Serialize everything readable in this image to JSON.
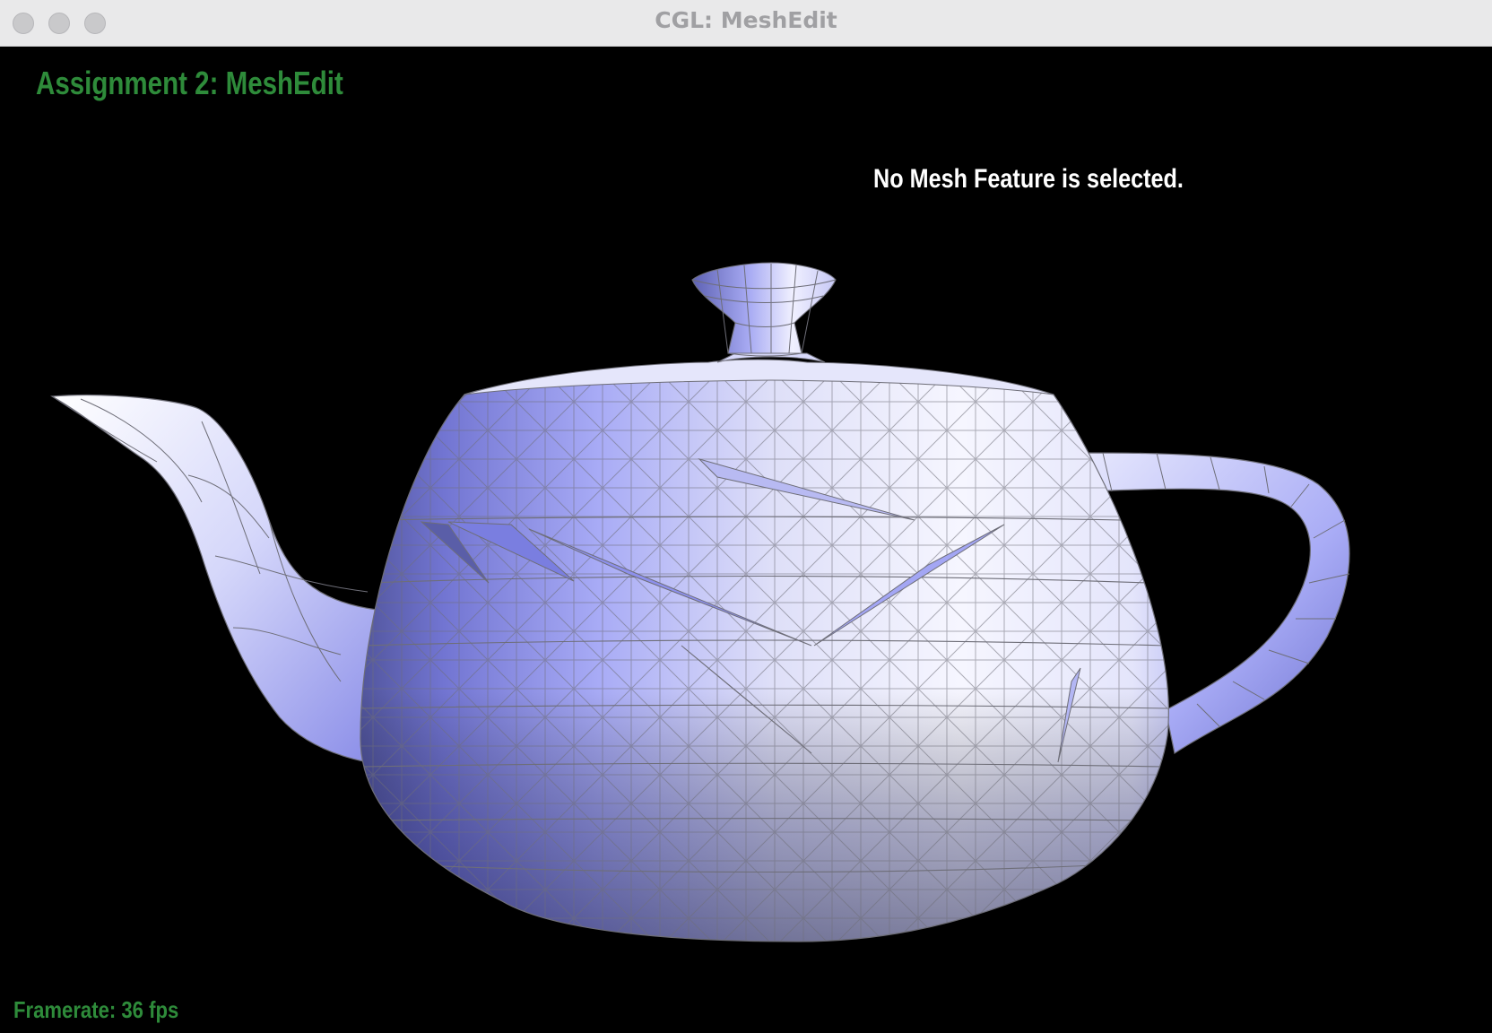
{
  "window": {
    "title": "CGL: MeshEdit",
    "controls": [
      "close",
      "minimize",
      "zoom"
    ]
  },
  "viewer": {
    "heading": "Assignment 2: MeshEdit",
    "status": "No Mesh Feature is selected.",
    "framerate": "Framerate: 36 fps",
    "model": "teapot-mesh",
    "colors": {
      "background": "#000000",
      "hud_text": "#2e8b3a",
      "status_text": "#ffffff",
      "mesh_light": "#f2f2ff",
      "mesh_mid": "#a4a7f6",
      "mesh_dark": "#5a5ea8",
      "wireframe": "#6e6e78"
    }
  }
}
